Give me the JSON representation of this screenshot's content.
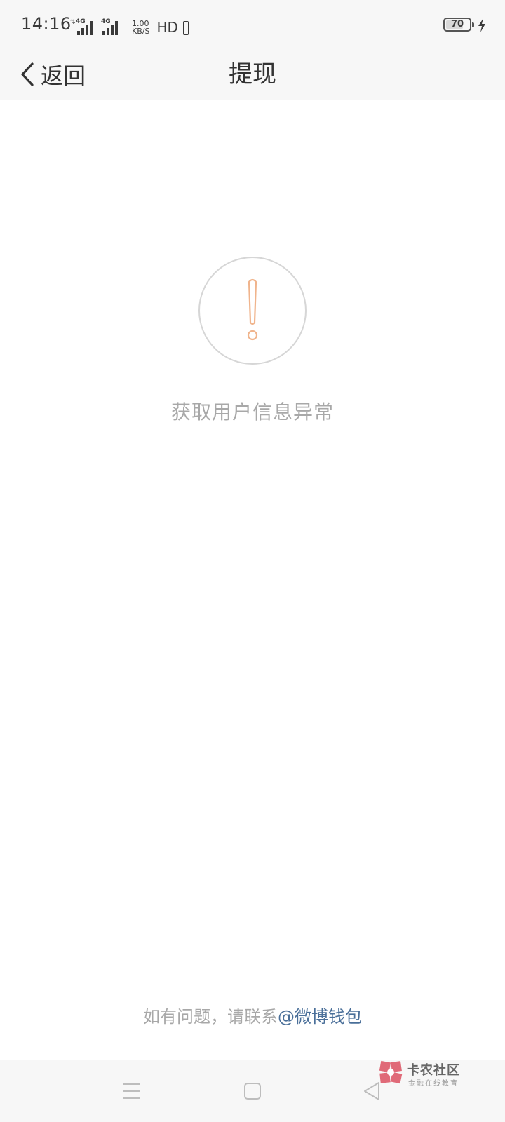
{
  "status_bar": {
    "time": "14:16",
    "signal1_label": "4G",
    "signal2_label": "4G",
    "net_speed_value": "1.00",
    "net_speed_unit": "KB/S",
    "hd_label": "HD",
    "battery_level": "70"
  },
  "nav": {
    "back_label": "返回",
    "title": "提现"
  },
  "content": {
    "error_message": "获取用户信息异常",
    "help_text": "如有问题，请联系",
    "help_link": "@微博钱包"
  },
  "watermark": {
    "title": "卡农社区",
    "subtitle": "金融在线教育"
  },
  "colors": {
    "accent_orange": "#f0b48c",
    "link_blue": "#4a6f99",
    "muted_text": "#a8a8a8"
  },
  "icons": {
    "back": "chevron-left-icon",
    "alert": "exclamation-icon",
    "menu": "menu-icon",
    "home": "square-icon",
    "nav_back": "triangle-back-icon",
    "charge": "lightning-icon"
  }
}
